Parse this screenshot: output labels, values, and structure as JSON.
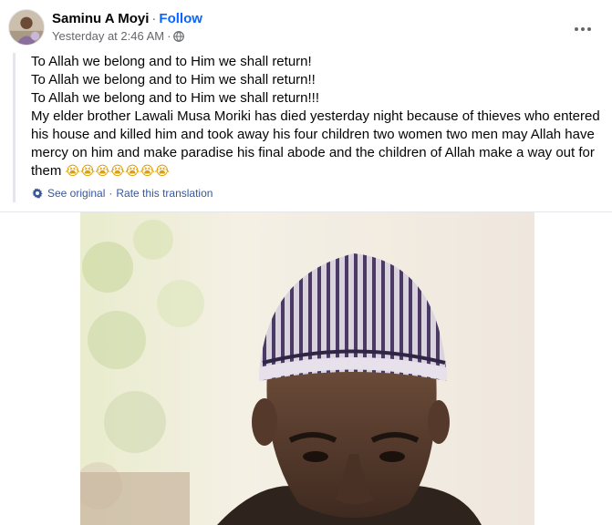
{
  "post": {
    "author": "Saminu A Moyi",
    "separator": "·",
    "follow_label": "Follow",
    "timestamp": "Yesterday at 2:46 AM",
    "meta_separator": "·",
    "audience_icon": "globe-icon",
    "more_icon": "more-horizontal-icon",
    "lines": [
      "To Allah we belong and to Him we shall return!",
      "To Allah we belong and to Him we shall return!!",
      "To Allah we belong and to Him we shall return!!!"
    ],
    "paragraph": "My elder brother Lawali Musa Moriki has died yesterday night because of thieves who entered his house and killed him and took away his four children two women two men may Allah have mercy on him and make paradise his final abode and the children of Allah make a way out for them",
    "emojis": "😭😭😭😭😭😭😭",
    "translation": {
      "icon": "gear-icon",
      "see_original": "See original",
      "separator": "·",
      "rate": "Rate this translation"
    }
  },
  "colors": {
    "link_blue": "#0866ff",
    "secondary_text": "#65676b",
    "translation_blue": "#385898",
    "divider": "#e4e6eb"
  }
}
